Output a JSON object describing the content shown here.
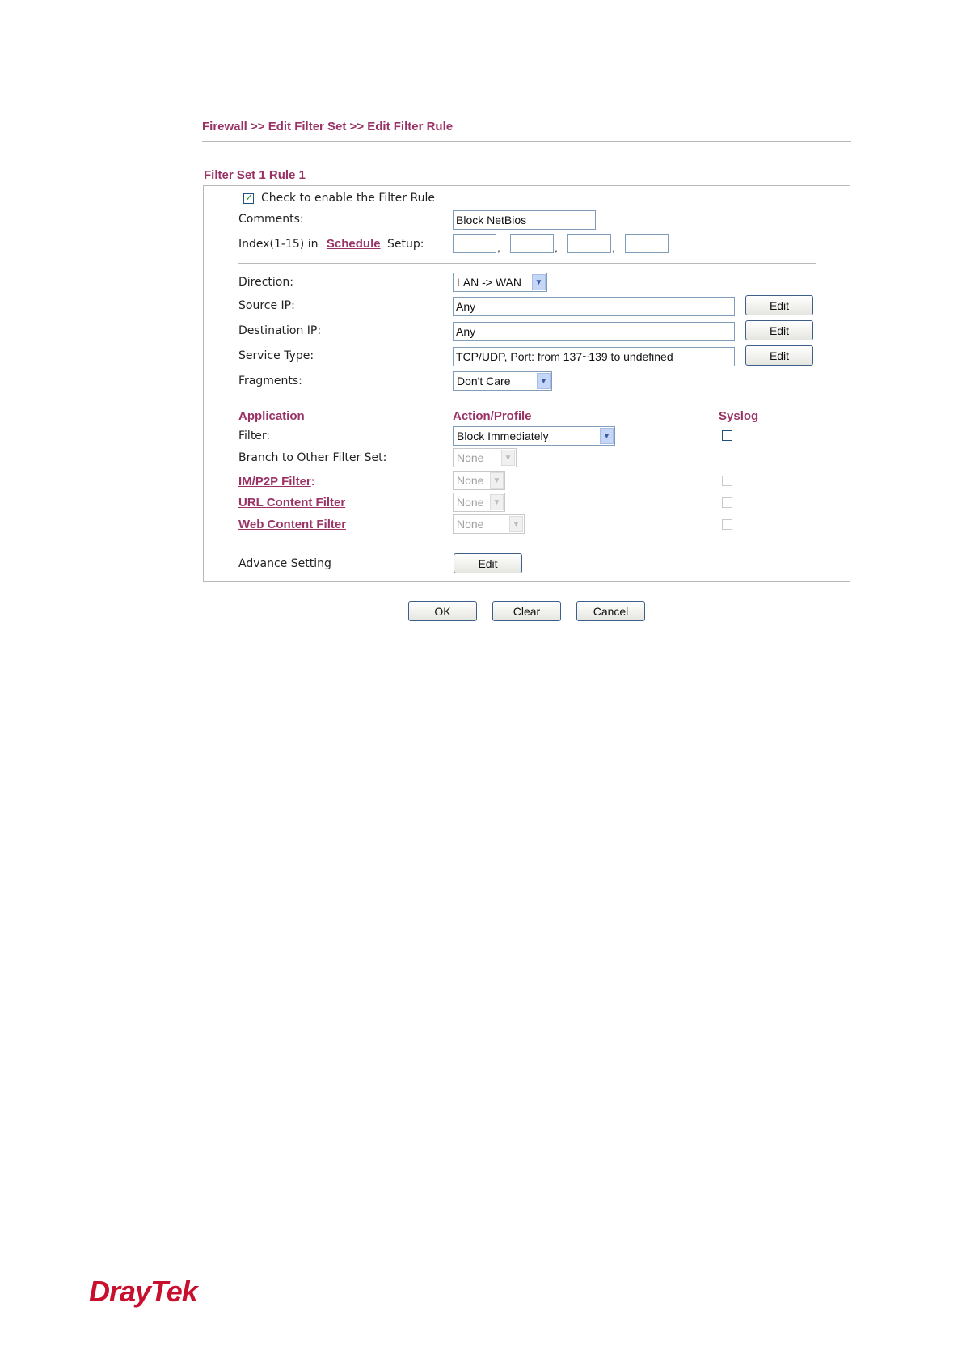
{
  "breadcrumb": "Firewall >> Edit Filter Set >> Edit Filter Rule",
  "set_title": "Filter Set 1 Rule 1",
  "enable_label": "Check to enable the Filter Rule",
  "enable_checked": true,
  "comments": {
    "label": "Comments:",
    "value": "Block NetBios"
  },
  "index": {
    "prefix": "Index(1-15) in",
    "link": "Schedule",
    "suffix": "Setup:",
    "values": [
      "",
      "",
      "",
      ""
    ],
    "sep": ","
  },
  "direction": {
    "label": "Direction:",
    "value": "LAN -> WAN"
  },
  "source_ip": {
    "label": "Source IP:",
    "value": "Any",
    "button": "Edit"
  },
  "destination_ip": {
    "label": "Destination IP:",
    "value": "Any",
    "button": "Edit"
  },
  "service_type": {
    "label": "Service Type:",
    "value": "TCP/UDP, Port: from 137~139 to undefined",
    "button": "Edit"
  },
  "fragments": {
    "label": "Fragments:",
    "value": "Don't Care"
  },
  "headers": {
    "application": "Application",
    "action": "Action/Profile",
    "syslog": "Syslog"
  },
  "filter": {
    "label": "Filter:",
    "value": "Block Immediately",
    "syslog": false
  },
  "branch": {
    "label": "Branch to Other Filter Set:",
    "value": "None"
  },
  "im_p2p": {
    "label": "IM/P2P Filter",
    "colon": ":",
    "value": "None",
    "syslog": false
  },
  "url_filter": {
    "label": "URL Content Filter",
    "value": "None",
    "syslog": false
  },
  "web_filter": {
    "label": "Web Content Filter",
    "value": "None",
    "syslog": false
  },
  "advance": {
    "label": "Advance Setting",
    "button": "Edit"
  },
  "buttons": {
    "ok": "OK",
    "clear": "Clear",
    "cancel": "Cancel"
  },
  "logo": {
    "text": "DrayTek"
  },
  "icons": {
    "dropdown": "chevron-down-icon",
    "check": "checkmark-icon"
  },
  "colors": {
    "accent": "#993366",
    "border": "#7f9db9",
    "logo": "#c8102e"
  }
}
